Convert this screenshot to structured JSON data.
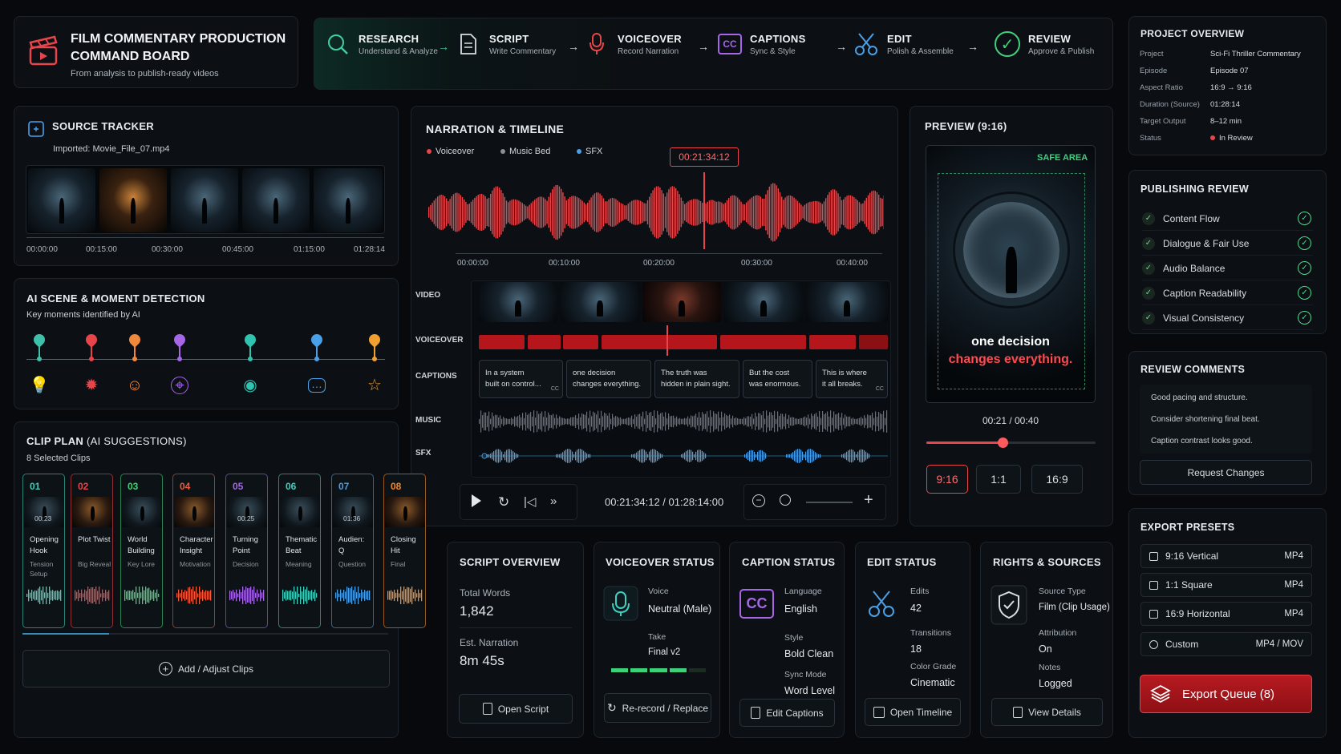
{
  "header": {
    "title_line1": "FILM COMMENTARY PRODUCTION",
    "title_line2": "COMMAND BOARD",
    "subtitle": "From analysis to publish-ready videos"
  },
  "pipeline": [
    {
      "title": "RESEARCH",
      "desc": "Understand & Analyze",
      "icon": "search-icon"
    },
    {
      "title": "SCRIPT",
      "desc": "Write Commentary",
      "icon": "document-icon"
    },
    {
      "title": "VOICEOVER",
      "desc": "Record Narration",
      "icon": "microphone-icon"
    },
    {
      "title": "CAPTIONS",
      "desc": "Sync & Style",
      "icon": "cc-icon"
    },
    {
      "title": "EDIT",
      "desc": "Polish & Assemble",
      "icon": "scissors-icon"
    },
    {
      "title": "REVIEW",
      "desc": "Approve & Publish",
      "icon": "check-circle-icon"
    }
  ],
  "source_tracker": {
    "title": "SOURCE TRACKER",
    "imported": "Imported: Movie_File_07.mp4",
    "times": [
      "00:00:00",
      "00:15:00",
      "00:30:00",
      "00:45:00",
      "01:15:00",
      "01:28:14"
    ]
  },
  "ai_detection": {
    "title": "AI SCENE & MOMENT DETECTION",
    "subtitle": "Key moments identified by AI",
    "markers": [
      {
        "color": "#3fc0a8",
        "icon": "lightbulb-icon"
      },
      {
        "color": "#e8454a",
        "icon": "burst-icon"
      },
      {
        "color": "#f08a3a",
        "icon": "drama-masks-icon"
      },
      {
        "color": "#a566e8",
        "icon": "crosshair-icon"
      },
      {
        "color": "#2fc4b0",
        "icon": "eye-icon"
      },
      {
        "color": "#4aa0e8",
        "icon": "chat-bubble-icon"
      },
      {
        "color": "#f0a030",
        "icon": "star-icon"
      }
    ]
  },
  "clip_plan": {
    "title": "CLIP PLAN",
    "title_suffix": "(AI SUGGESTIONS)",
    "count": "8 Selected Clips",
    "add_label": "Add / Adjust Clips",
    "clips": [
      {
        "num": "01",
        "label": "Opening\nHook",
        "sub": "Tension\nSetup",
        "time": "00:23",
        "color": "#3fd0b8"
      },
      {
        "num": "02",
        "label": "Plot Twist",
        "sub": "Big Reveal",
        "time": "",
        "color": "#e8454a"
      },
      {
        "num": "03",
        "label": "World\nBuilding",
        "sub": "Key Lore",
        "time": "",
        "color": "#3fd07a"
      },
      {
        "num": "04",
        "label": "Character\nInsight",
        "sub": "Motivation",
        "time": "",
        "color": "#f05a3a"
      },
      {
        "num": "05",
        "label": "Turning\nPoint",
        "sub": "Decision",
        "time": "00:25",
        "color": "#a566e8"
      },
      {
        "num": "06",
        "label": "Thematic\nBeat",
        "sub": "Meaning",
        "time": "",
        "color": "#3fd0c0"
      },
      {
        "num": "07",
        "label": "Audien:\nQ",
        "sub": "Question",
        "time": "01:36",
        "color": "#4aa0e8"
      },
      {
        "num": "08",
        "label": "Closing\nHit",
        "sub": "Final",
        "time": "",
        "color": "#f08a2a"
      }
    ]
  },
  "narration": {
    "title": "NARRATION & TIMELINE",
    "legend": [
      {
        "label": "Voiceover",
        "color": "#e8454a"
      },
      {
        "label": "Music Bed",
        "color": "#8a9098"
      },
      {
        "label": "SFX",
        "color": "#4aa0e8"
      }
    ],
    "playhead": "00:21:34:12",
    "ruler": [
      "00:00:00",
      "00:10:00",
      "00:20:00",
      "00:30:00",
      "00:40:00"
    ],
    "rows": [
      "VIDEO",
      "VOICEOVER",
      "CAPTIONS",
      "MUSIC",
      "SFX"
    ],
    "captions": [
      "In a system\nbuilt on control...",
      "one decision\nchanges everything.",
      "The truth was\nhidden in plain sight.",
      "But the cost\nwas enormous.",
      "This is where\nit all breaks."
    ],
    "cc": "CC",
    "timecode": "00:21:34:12 / 01:28:14:00"
  },
  "preview": {
    "title": "PREVIEW (9:16)",
    "safe_area": "SAFE AREA",
    "line1": "one decision",
    "line2": "changes everything.",
    "time": "00:21 / 00:40",
    "progress": 0.45,
    "ratios": [
      "9:16",
      "1:1",
      "16:9"
    ]
  },
  "project_overview": {
    "title": "PROJECT OVERVIEW",
    "rows": [
      {
        "k": "Project",
        "v": "Sci-Fi Thriller Commentary"
      },
      {
        "k": "Episode",
        "v": "Episode 07"
      },
      {
        "k": "Aspect Ratio",
        "v": "16:9 → 9:16"
      },
      {
        "k": "Duration (Source)",
        "v": "01:28:14"
      },
      {
        "k": "Target Output",
        "v": "8–12 min"
      },
      {
        "k": "Status",
        "v": "In Review"
      }
    ]
  },
  "publishing_review": {
    "title": "PUBLISHING REVIEW",
    "items": [
      "Content Flow",
      "Dialogue & Fair Use",
      "Audio Balance",
      "Caption Readability",
      "Visual Consistency"
    ]
  },
  "review_comments": {
    "title": "REVIEW COMMENTS",
    "comments": [
      "Good pacing and structure.",
      "Consider shortening final beat.",
      "Caption contrast looks good."
    ],
    "button": "Request Changes"
  },
  "export_presets": {
    "title": "EXPORT PRESETS",
    "presets": [
      {
        "name": "9:16 Vertical",
        "fmt": "MP4"
      },
      {
        "name": "1:1 Square",
        "fmt": "MP4"
      },
      {
        "name": "16:9 Horizontal",
        "fmt": "MP4"
      },
      {
        "name": "Custom",
        "fmt": "MP4 / MOV"
      }
    ],
    "queue": "Export Queue (8)"
  },
  "script_overview": {
    "title": "SCRIPT OVERVIEW",
    "words_label": "Total Words",
    "words": "1,842",
    "narr_label": "Est. Narration",
    "narr": "8m 45s",
    "button": "Open Script"
  },
  "voiceover_status": {
    "title": "VOICEOVER STATUS",
    "voice_label": "Voice",
    "voice": "Neutral (Male)",
    "take_label": "Take",
    "take": "Final v2",
    "button": "Re-record / Replace"
  },
  "caption_status": {
    "title": "CAPTION STATUS",
    "lang_label": "Language",
    "lang": "English",
    "style_label": "Style",
    "style": "Bold Clean",
    "sync_label": "Sync Mode",
    "sync": "Word Level",
    "button": "Edit Captions"
  },
  "edit_status": {
    "title": "EDIT STATUS",
    "edits_label": "Edits",
    "edits": "42",
    "trans_label": "Transitions",
    "trans": "18",
    "grade_label": "Color Grade",
    "grade": "Cinematic",
    "button": "Open Timeline"
  },
  "rights_sources": {
    "title": "RIGHTS & SOURCES",
    "type_label": "Source Type",
    "type": "Film (Clip Usage)",
    "attr_label": "Attribution",
    "attr": "On",
    "notes_label": "Notes",
    "notes": "Logged",
    "button": "View Details"
  },
  "colors": {
    "accent_red": "#e8454a",
    "accent_green": "#3fd0a0",
    "bg": "#07090c"
  }
}
